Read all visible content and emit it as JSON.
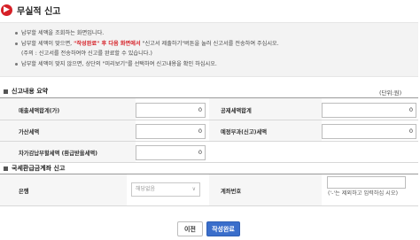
{
  "title": "무실적 신고",
  "notice": {
    "line1": "납부할 세액을 조회하는 화면입니다.",
    "line2_pre": "납부할 세액이 맞으면,",
    "line2_red": "\"작성완료\" 후 다음 화면에서",
    "line2_post": "\"신고서 제출하기\"버튼을 눌러 신고서를 전송하여 주십시오.",
    "line3": "(주의 : 신고서를 전송하여야 신고를 완료할 수 있습니다.)",
    "line4": "납부할 세액이 맞지 않으면, 상단의 \"미리보기\"를 선택하여 신고내용을 확인 하십시오."
  },
  "summary": {
    "heading": "신고내용 요약",
    "unit": "(단위:원)",
    "rows": [
      {
        "left_label": "매출세액합계(가)",
        "left_value": "0",
        "right_label": "공제세액합계",
        "right_value": "0"
      },
      {
        "left_label": "가산세액",
        "left_value": "0",
        "right_label": "예정부과(신고)세액",
        "right_value": "0"
      },
      {
        "left_label": "차가감납부할세액 (환급받을세액)",
        "left_value": "0"
      }
    ]
  },
  "refund": {
    "heading": "국세환급금계좌 신고",
    "bank_label": "은행",
    "bank_selected": "해당없음",
    "account_label": "계좌번호",
    "account_value": "",
    "account_hint": "('-'는 제외하고 입력하십 시오)"
  },
  "buttons": {
    "prev": "이전",
    "done": "작성완료"
  }
}
